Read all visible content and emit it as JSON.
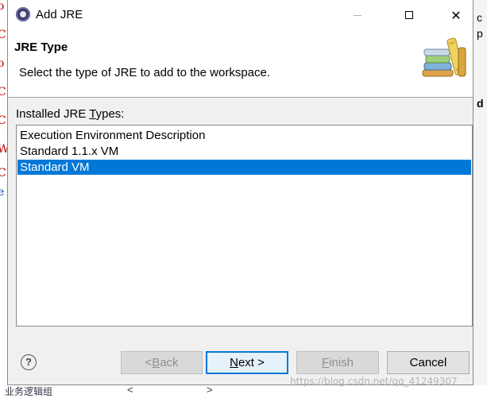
{
  "window": {
    "title": "Add JRE",
    "minimize_symbol": "",
    "maximize_symbol": "",
    "close_symbol": "✕"
  },
  "header": {
    "page_title": "JRE Type",
    "description": "Select the type of JRE to add to the workspace."
  },
  "jre_types": {
    "label_prefix": "Installed JRE ",
    "label_mnemonic": "T",
    "label_suffix": "ypes:",
    "items": [
      {
        "label": "Execution Environment Description",
        "selected": false
      },
      {
        "label": "Standard 1.1.x VM",
        "selected": false
      },
      {
        "label": "Standard VM",
        "selected": true
      }
    ]
  },
  "buttons": {
    "help_symbol": "?",
    "back": {
      "prefix": "< ",
      "mnemonic": "B",
      "suffix": "ack",
      "enabled": false
    },
    "next": {
      "prefix": "",
      "mnemonic": "N",
      "suffix": "ext >",
      "enabled": true
    },
    "finish": {
      "prefix": "",
      "mnemonic": "F",
      "suffix": "inish",
      "enabled": false
    },
    "cancel": {
      "label": "Cancel",
      "enabled": true
    }
  },
  "background": {
    "left_fragments": [
      "o",
      "C",
      "o",
      "C",
      "C",
      "W",
      "C",
      "e"
    ],
    "right_fragments": [
      "c",
      "p",
      "d"
    ],
    "bottom_text": "业务逻辑组",
    "bottom_arrows": [
      "<",
      ">"
    ],
    "watermark": "https://blog.csdn.net/qq_41249307"
  },
  "colors": {
    "selection": "#0078d7",
    "dialog_bg": "#f0f0f0",
    "default_button_border": "#0078d7"
  }
}
